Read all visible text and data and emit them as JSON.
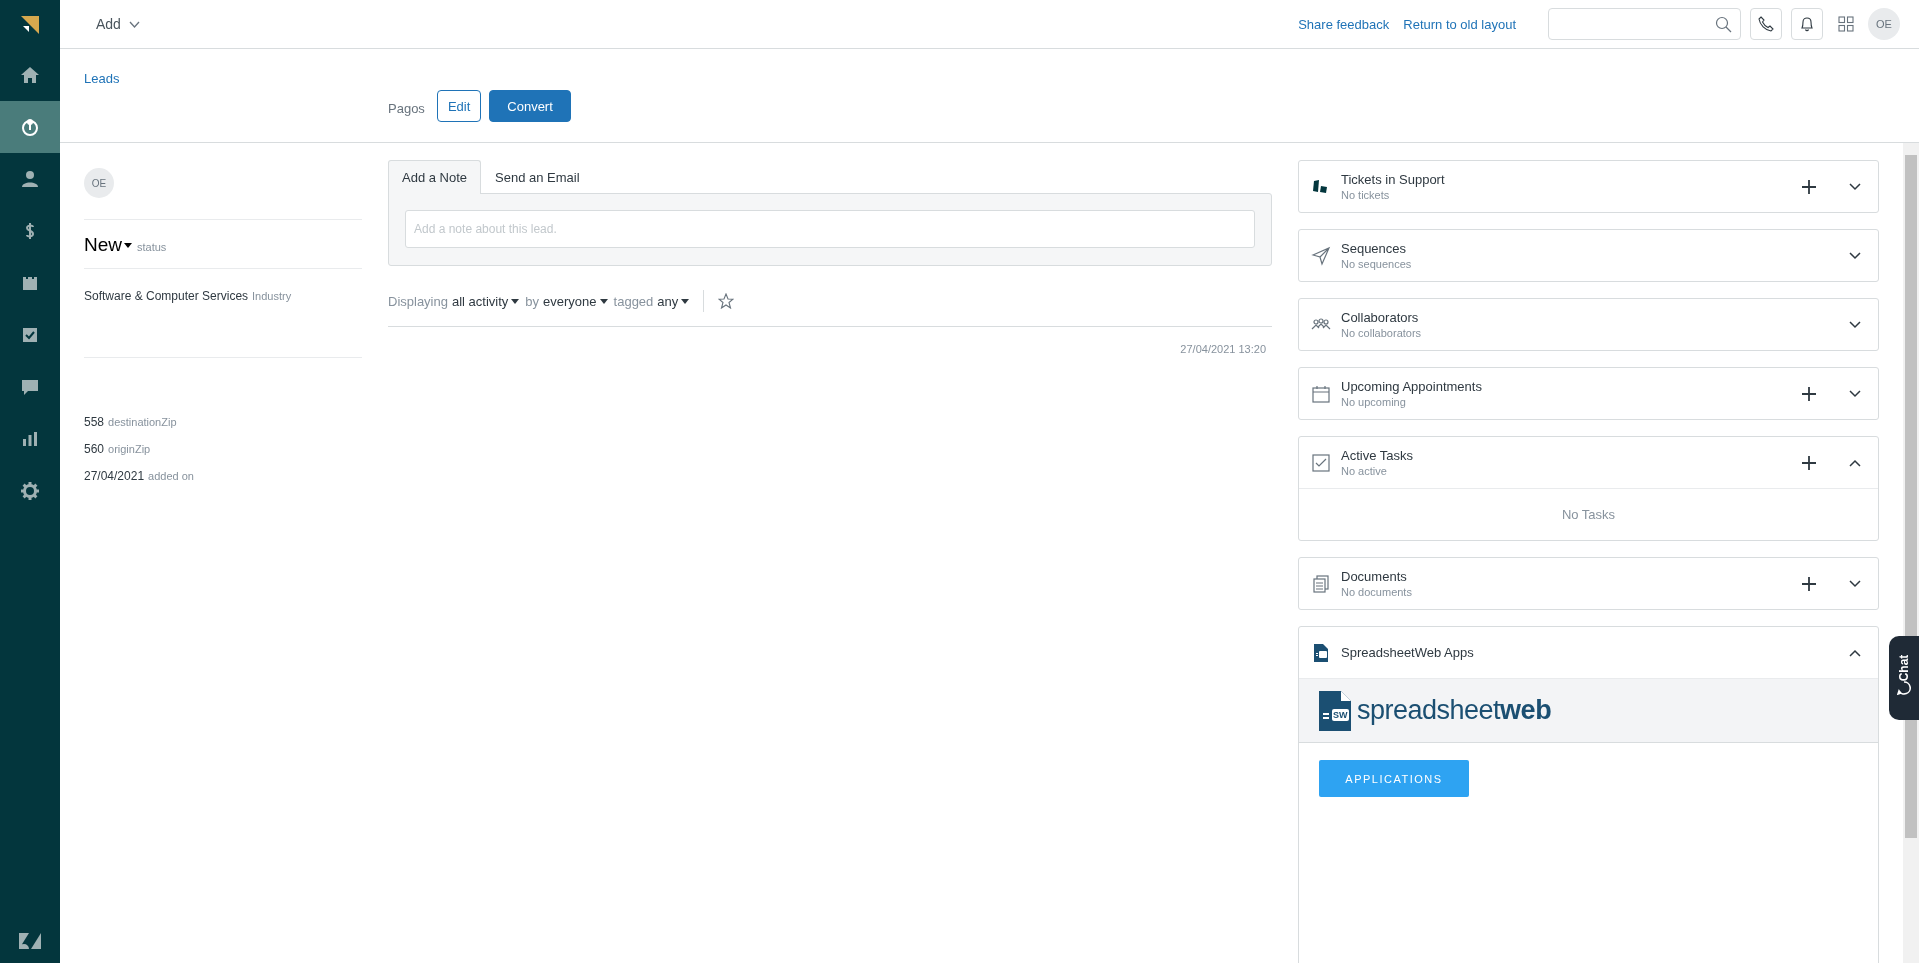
{
  "sidebar": {
    "items": [
      {
        "kind": "home",
        "selected": false
      },
      {
        "kind": "leads",
        "selected": true
      },
      {
        "kind": "contacts",
        "selected": false
      },
      {
        "kind": "deals",
        "selected": false
      },
      {
        "kind": "calendar",
        "selected": false
      },
      {
        "kind": "tasks",
        "selected": false
      },
      {
        "kind": "messages",
        "selected": false
      },
      {
        "kind": "reports",
        "selected": false
      },
      {
        "kind": "settings",
        "selected": false
      }
    ]
  },
  "top_bar": {
    "add_menu": "Add",
    "links": [
      "Share feedback",
      "Return to old layout"
    ],
    "avatar": "OE"
  },
  "breadcrumb": "Leads",
  "actions": {
    "label": "Pagos",
    "buttons": [
      {
        "label": "Edit",
        "kind": "outline"
      },
      {
        "label": "Convert",
        "kind": "primary"
      }
    ]
  },
  "lead": {
    "avatar": "OE",
    "status": {
      "value": "New",
      "label": "status"
    },
    "industry": {
      "value": "Software & Computer Services",
      "label": "Industry"
    },
    "fields": [
      {
        "value": "558",
        "label": "destinationZip"
      },
      {
        "value": "560",
        "label": "originZip"
      },
      {
        "value": "27/04/2021",
        "label": "added on"
      }
    ]
  },
  "composer": {
    "tabs": [
      {
        "label": "Add a Note",
        "selected": true
      },
      {
        "label": "Send an Email",
        "selected": false
      }
    ],
    "placeholder": "Add a note about this lead."
  },
  "filters": [
    {
      "label": "Displaying",
      "value": "all activity"
    },
    {
      "label": "by",
      "value": "everyone"
    },
    {
      "label": "tagged",
      "value": "any"
    }
  ],
  "activity": {
    "timestamp": "27/04/2021 13:20"
  },
  "panels": [
    {
      "kind": "tickets",
      "title": "Tickets in Support",
      "subtitle": "No tickets",
      "addable": true,
      "expanded": false
    },
    {
      "kind": "sequences",
      "title": "Sequences",
      "subtitle": "No sequences",
      "addable": false,
      "expanded": false
    },
    {
      "kind": "collaborators",
      "title": "Collaborators",
      "subtitle": "No collaborators",
      "addable": false,
      "expanded": false
    },
    {
      "kind": "appointments",
      "title": "Upcoming Appointments",
      "subtitle": "No upcoming",
      "addable": true,
      "expanded": false
    },
    {
      "kind": "tasks",
      "title": "Active Tasks",
      "subtitle": "No active",
      "addable": true,
      "expanded": true,
      "body": "No Tasks"
    },
    {
      "kind": "documents",
      "title": "Documents",
      "subtitle": "No documents",
      "addable": true,
      "expanded": false
    },
    {
      "kind": "apps",
      "title": "SpreadsheetWeb Apps",
      "addable": false,
      "expanded": true,
      "app": {
        "badge": "SW",
        "logo": "spreadsheet**web**",
        "button": "APPLICATIONS"
      }
    }
  ],
  "chat_tab": {
    "label": "Chat"
  }
}
